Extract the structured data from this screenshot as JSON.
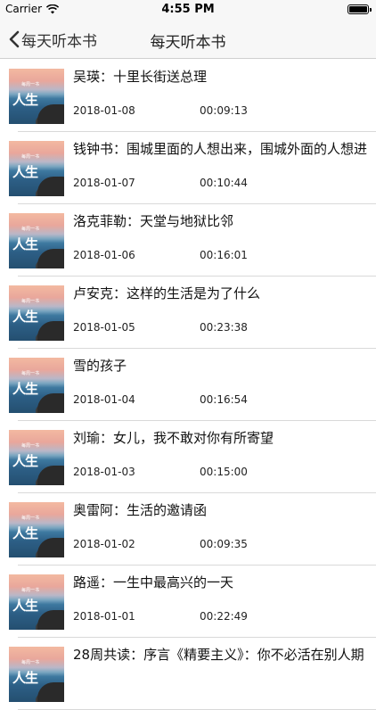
{
  "status_bar": {
    "carrier": "Carrier",
    "time": "4:55 PM",
    "wifi_icon": "wifi-icon",
    "battery_icon": "battery-icon"
  },
  "nav": {
    "back_label": "每天听本书",
    "title": "每天听本书",
    "back_icon": "chevron-left-icon"
  },
  "thumbnail": {
    "glyph": "人生",
    "tag": "每周一书"
  },
  "items": [
    {
      "title": "吴瑛：十里长街送总理",
      "date": "2018-01-08",
      "duration": "00:09:13"
    },
    {
      "title": "钱钟书：围城里面的人想出来，围城外面的人想进",
      "date": "2018-01-07",
      "duration": "00:10:44"
    },
    {
      "title": "洛克菲勒：天堂与地狱比邻",
      "date": "2018-01-06",
      "duration": "00:16:01"
    },
    {
      "title": "卢安克：这样的生活是为了什么",
      "date": "2018-01-05",
      "duration": "00:23:38"
    },
    {
      "title": "雪的孩子",
      "date": "2018-01-04",
      "duration": "00:16:54"
    },
    {
      "title": "刘瑜：女儿，我不敢对你有所寄望",
      "date": "2018-01-03",
      "duration": "00:15:00"
    },
    {
      "title": "奥雷阿：生活的邀请函",
      "date": "2018-01-02",
      "duration": "00:09:35"
    },
    {
      "title": "路遥：一生中最高兴的一天",
      "date": "2018-01-01",
      "duration": "00:22:49"
    },
    {
      "title": "28周共读：序言《精要主义》：你不必活在别人期",
      "date": "",
      "duration": ""
    }
  ]
}
